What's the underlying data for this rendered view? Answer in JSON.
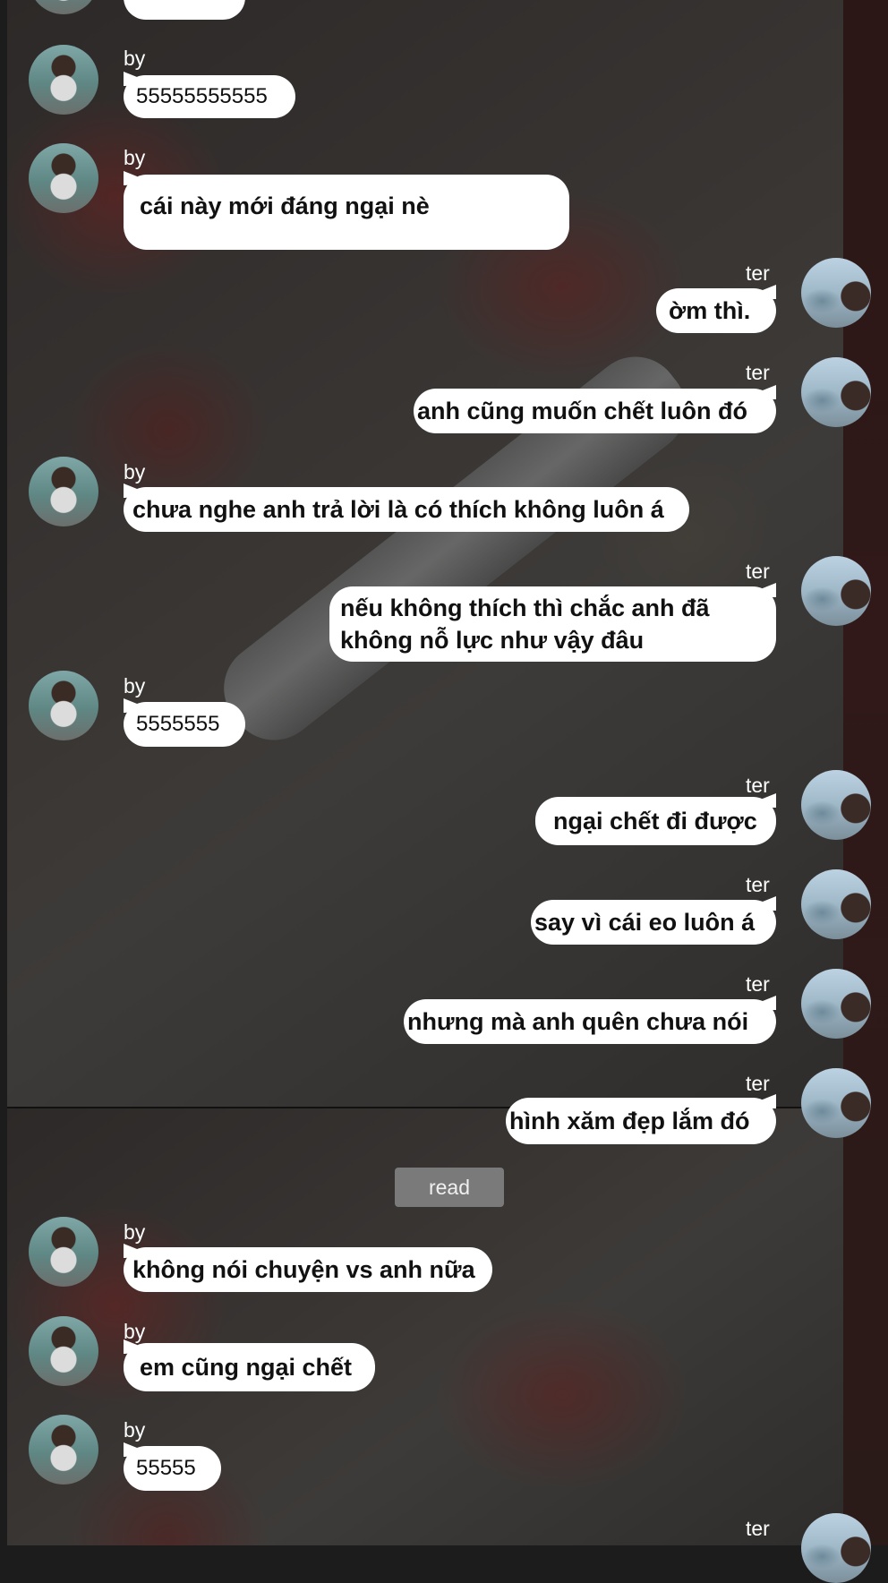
{
  "chat": {
    "messages": [
      {
        "sender": "by",
        "text": "55555555555"
      },
      {
        "sender": "by",
        "text": "cái này mới đáng ngại nè"
      },
      {
        "sender": "ter",
        "text": "ờm thì."
      },
      {
        "sender": "ter",
        "text": "anh cũng muốn chết luôn đó"
      },
      {
        "sender": "by",
        "text": "chưa nghe anh trả lời là có thích không luôn á"
      },
      {
        "sender": "ter",
        "text": "nếu không thích thì chắc anh đã không nỗ lực như vậy đâu"
      },
      {
        "sender": "by",
        "text": "5555555"
      },
      {
        "sender": "ter",
        "text": "ngại chết đi được"
      },
      {
        "sender": "ter",
        "text": "say vì cái eo luôn á"
      },
      {
        "sender": "ter",
        "text": "nhưng mà anh quên chưa nói"
      },
      {
        "sender": "ter",
        "text": "hình xăm đẹp lắm đó"
      },
      {
        "sender": "by",
        "text": "không nói chuyện vs anh nữa"
      },
      {
        "sender": "by",
        "text": "em cũng ngại chết"
      },
      {
        "sender": "by",
        "text": "55555"
      },
      {
        "sender": "ter",
        "text": ""
      }
    ],
    "read_label": "read"
  }
}
